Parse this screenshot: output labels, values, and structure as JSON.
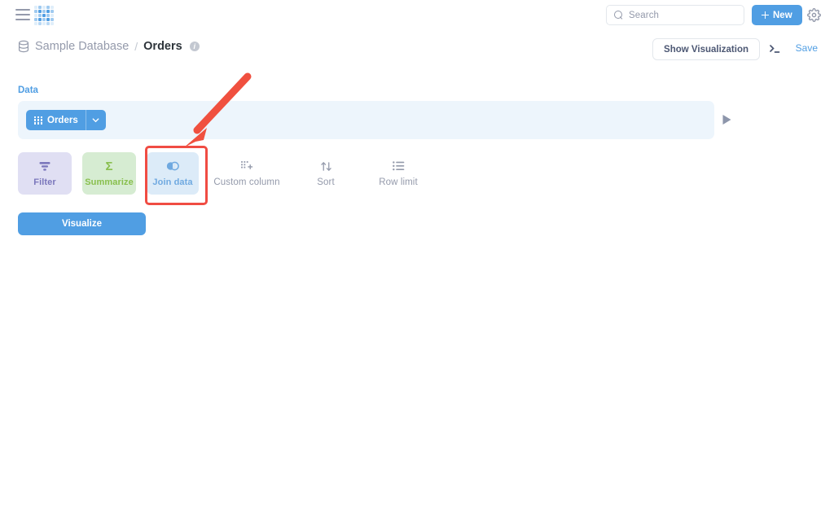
{
  "topnav": {
    "menu_icon": "hamburger-icon",
    "logo_icon": "metabase-logo",
    "search": {
      "placeholder": "Search",
      "value": "",
      "icon": "search-icon"
    },
    "new_button": {
      "label": "New",
      "icon": "plus-icon"
    },
    "settings_icon": "gear-icon"
  },
  "header": {
    "breadcrumb": {
      "database_icon": "database-icon",
      "database": "Sample Database",
      "separator": "/",
      "table": "Orders",
      "info_icon": "info-icon",
      "info_glyph": "i"
    },
    "show_visualization_label": "Show Visualization",
    "console_icon": "sql-console-icon",
    "save_label": "Save"
  },
  "notebook": {
    "data_section_label": "Data",
    "source_table": {
      "label": "Orders",
      "grid_icon": "table-grid-icon",
      "chevron_icon": "chevron-down-icon"
    },
    "run_icon": "play-icon",
    "actions": [
      {
        "label": "Filter",
        "icon": "filter-funnel-icon",
        "state": "available"
      },
      {
        "label": "Summarize",
        "icon": "sigma-icon",
        "state": "available",
        "glyph": "Σ"
      },
      {
        "label": "Join data",
        "icon": "join-venn-icon",
        "state": "highlighted"
      },
      {
        "label": "Custom column",
        "icon": "custom-column-icon",
        "state": "plain"
      },
      {
        "label": "Sort",
        "icon": "sort-arrows-icon",
        "state": "plain"
      },
      {
        "label": "Row limit",
        "icon": "row-limit-icon",
        "state": "plain"
      }
    ],
    "visualize_label": "Visualize"
  },
  "annotations": {
    "highlight_target": "Join data",
    "highlight_color": "#f04c43",
    "arrow_color": "#f0503f"
  },
  "colors": {
    "brand_blue": "#509ee3",
    "filter_purple": "#7b77bc",
    "summarize_green": "#88bf4d",
    "text_dark": "#2e353b",
    "text_muted": "#949aab"
  }
}
